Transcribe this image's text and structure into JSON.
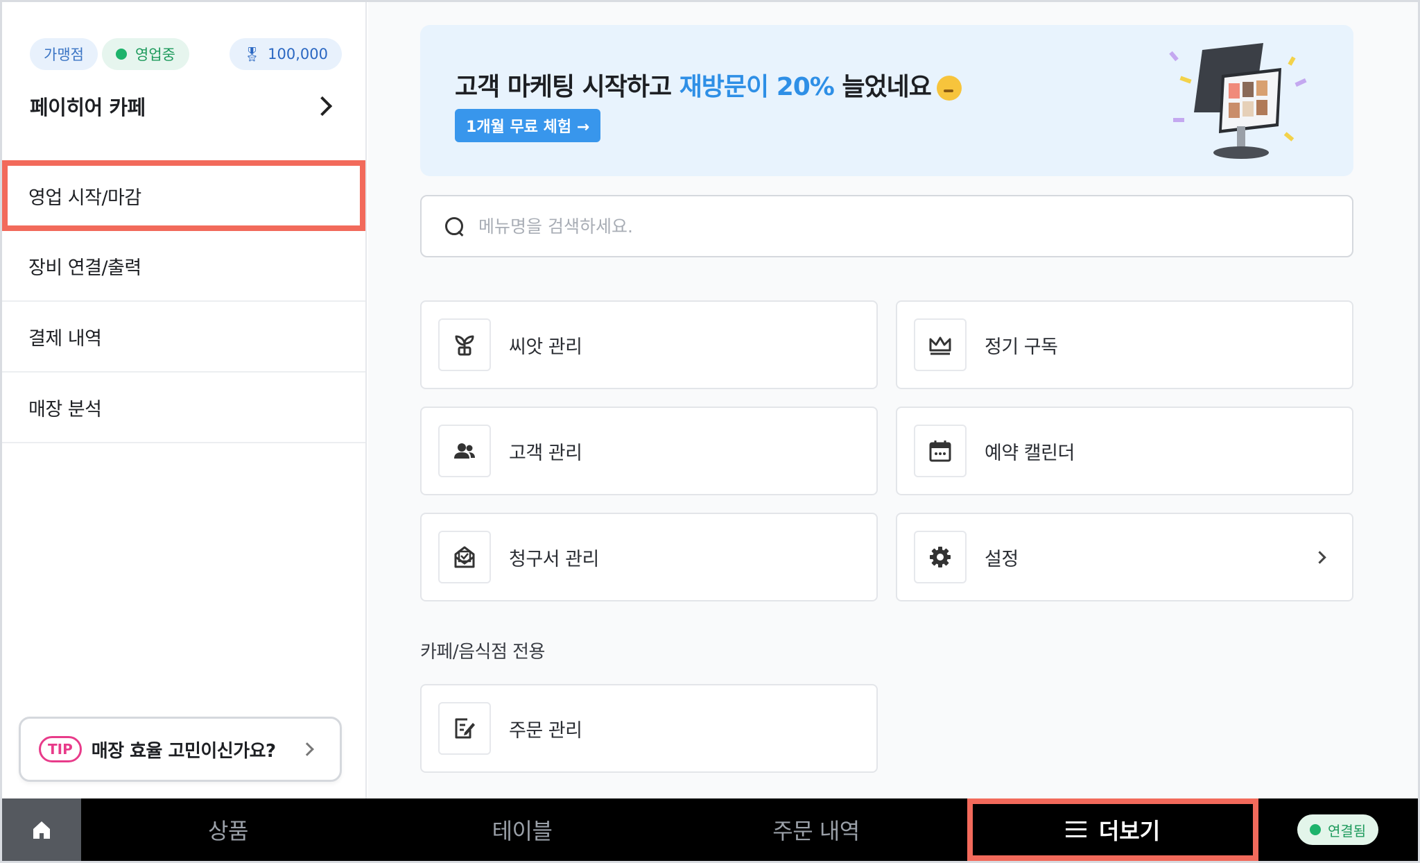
{
  "sidebar": {
    "badges": {
      "franchise": "가맹점",
      "status": "영업중",
      "points": "100,000"
    },
    "store_name": "페이히어 카페",
    "items": [
      {
        "label": "영업 시작/마감"
      },
      {
        "label": "장비 연결/출력"
      },
      {
        "label": "결제 내역"
      },
      {
        "label": "매장 분석"
      }
    ],
    "tip": {
      "badge": "TIP",
      "text": "매장 효율 고민이신가요?"
    }
  },
  "banner": {
    "title_prefix": "고객 마케팅 시작하고 ",
    "title_highlight": "재방문이 20%",
    "title_suffix": " 늘었네요",
    "button": "1개월 무료 체험 →"
  },
  "search": {
    "placeholder": "메뉴명을 검색하세요."
  },
  "cards": {
    "seed": "씨앗 관리",
    "subscription": "정기 구독",
    "customers": "고객 관리",
    "calendar": "예약 캘린더",
    "invoice": "청구서 관리",
    "settings": "설정"
  },
  "section": {
    "title": "카페/음식점 전용",
    "order_card": "주문 관리"
  },
  "bottombar": {
    "tabs": [
      "상품",
      "테이블",
      "주문 내역"
    ],
    "more": "더보기",
    "connection": "연결됨"
  },
  "colors": {
    "accent": "#2e8fe6",
    "highlight_border": "#f26a5b",
    "status_green": "#1db36b",
    "tip_pink": "#e83b8a"
  },
  "icons": {
    "badge_points": "medal-icon",
    "store_arrow": "chevron-right-icon",
    "search": "search-icon",
    "seed": "sprout-icon",
    "subscription": "crown-icon",
    "customers": "users-icon",
    "calendar": "calendar-icon",
    "invoice": "mail-invoice-icon",
    "settings": "gear-icon",
    "order": "edit-note-icon",
    "home": "home-icon",
    "more": "hamburger-icon"
  }
}
